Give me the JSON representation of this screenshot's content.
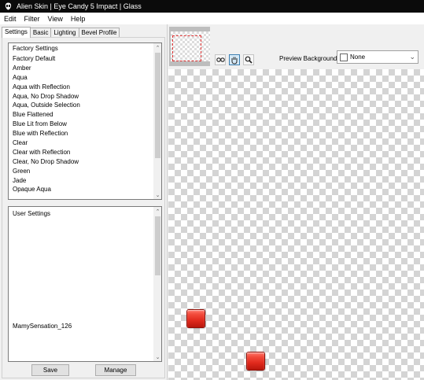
{
  "window": {
    "title": "Alien Skin | Eye Candy 5 Impact | Glass"
  },
  "menu": [
    "Edit",
    "Filter",
    "View",
    "Help"
  ],
  "tabs": [
    "Settings",
    "Basic",
    "Lighting",
    "Bevel Profile"
  ],
  "factory": {
    "header": "Factory Settings",
    "items": [
      "Factory Default",
      "Amber",
      "Aqua",
      "Aqua with Reflection",
      "Aqua, No Drop Shadow",
      "Aqua, Outside Selection",
      "Blue Flattened",
      "Blue Lit from Below",
      "Blue with Reflection",
      "Clear",
      "Clear with Reflection",
      "Clear, No Drop Shadow",
      "Green",
      "Jade",
      "Opaque Aqua"
    ]
  },
  "user": {
    "header": "User Settings",
    "items": [
      "MamySensation_126"
    ]
  },
  "buttons": {
    "save": "Save",
    "manage": "Manage"
  },
  "preview": {
    "label": "Preview Background:",
    "value": "None"
  },
  "colors": {
    "glass_red": "#e12a1d",
    "titlebar": "#0b0b0b",
    "thumb_selection": "#e03030"
  }
}
